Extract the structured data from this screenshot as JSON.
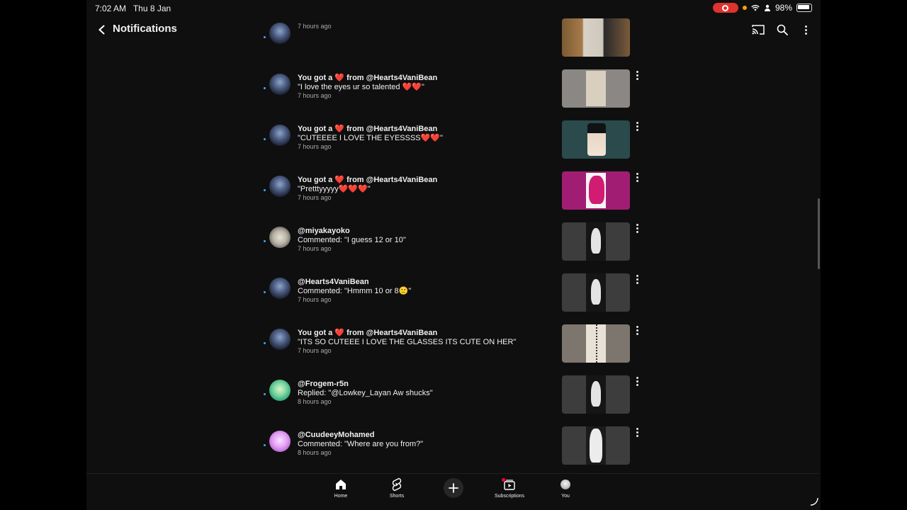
{
  "status_bar": {
    "time": "7:02 AM",
    "date": "Thu 8 Jan",
    "battery": "98%"
  },
  "header": {
    "title": "Notifications"
  },
  "notifications": [
    {
      "avatar": "hearts",
      "line1": "",
      "line2": "",
      "time": "7 hours ago",
      "thumb": "t-brown",
      "partial": true
    },
    {
      "avatar": "hearts",
      "pre": "You got a ",
      "heart": "❤️",
      "post": " from @Hearts4VaniBean",
      "line2": "\"I love the eyes ur so talented ❤️❤️\"",
      "time": "7 hours ago",
      "thumb": "t-sketch"
    },
    {
      "avatar": "hearts",
      "pre": "You got a ",
      "heart": "❤️",
      "post": " from @Hearts4VaniBean",
      "line2": "\"CUTEEEE I LOVE THE EYESSSS❤️❤️\"",
      "time": "7 hours ago",
      "thumb": "t-teal"
    },
    {
      "avatar": "hearts",
      "pre": "You got a ",
      "heart": "❤️",
      "post": " from @Hearts4VaniBean",
      "line2": "\"Pretttyyyyy❤️❤️❤️\"",
      "time": "7 hours ago",
      "thumb": "t-magenta"
    },
    {
      "avatar": "miya",
      "line1": "@miyakayoko",
      "line2": "Commented: \"I guess 12 or 10\"",
      "time": "7 hours ago",
      "thumb": "t-gray"
    },
    {
      "avatar": "hearts",
      "line1": "@Hearts4VaniBean",
      "line2": "Commented: \"Hmmm 10 or 8🙂\"",
      "time": "7 hours ago",
      "thumb": "t-gray"
    },
    {
      "avatar": "hearts",
      "pre": "You got a ",
      "heart": "❤️",
      "post": " from @Hearts4VaniBean",
      "line2": "\"ITS SO CUTEEE I LOVE THE GLASSES ITS CUTE ON HER\"",
      "time": "7 hours ago",
      "thumb": "t-note"
    },
    {
      "avatar": "frog",
      "line1": "@Frogem-r5n",
      "line2": "Replied: \"@Lowkey_Layan Aw shucks\"",
      "time": "8 hours ago",
      "thumb": "t-gray"
    },
    {
      "avatar": "cudd",
      "line1": "@CuudeeyMohamed",
      "line2": "Commented: \"Where are you from?\"",
      "time": "8 hours ago",
      "thumb": "t-white"
    }
  ],
  "bottom_nav": {
    "home": "Home",
    "shorts": "Shorts",
    "subscriptions": "Subscriptions",
    "you": "You"
  },
  "colors": {
    "background": "#0f0f0f",
    "heart": "#ff3b3b",
    "unread_dot": "#3ea6ff",
    "record": "#e0322f"
  }
}
